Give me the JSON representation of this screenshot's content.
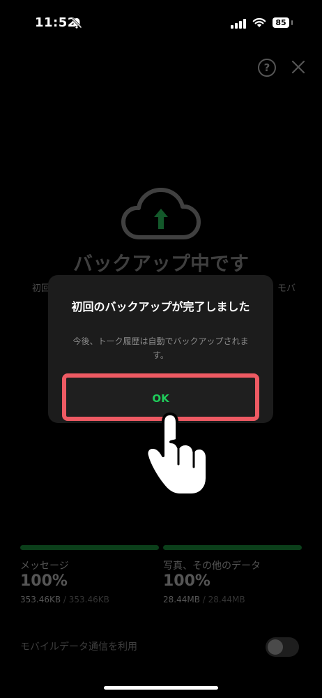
{
  "status_bar": {
    "time": "11:52",
    "battery": "85"
  },
  "icons": {
    "bell_muted": "bell-muted-icon",
    "signal": "signal-icon",
    "wifi": "wifi-icon",
    "help": "help-icon",
    "close": "close-icon",
    "cloud_upload": "cloud-upload-icon",
    "pointer_hand": "pointer-hand-icon"
  },
  "top_actions": {
    "help_glyph": "?"
  },
  "main": {
    "title": "バックアップ中です",
    "subtitle_left": "初回",
    "subtitle_right": "モバ"
  },
  "dialog": {
    "title": "初回のバックアップが完了しました",
    "message": "今後、トーク履歴は自動でバックアップされます。",
    "ok_label": "OK"
  },
  "progress": [
    {
      "label": "メッセージ",
      "percent": "100%",
      "done": "353.46KB",
      "total": " / 353.46KB",
      "fraction": 1.0
    },
    {
      "label": "写真、その他のデータ",
      "percent": "100%",
      "done": "28.44MB",
      "total": " / 28.44MB",
      "fraction": 1.0
    }
  ],
  "settings": {
    "mobile_data_label": "モバイルデータ通信を利用",
    "mobile_data_enabled": false
  },
  "colors": {
    "accent_green": "#1fcb5a",
    "highlight_red": "#ee5a63",
    "progress_green": "#0b3f1a"
  }
}
